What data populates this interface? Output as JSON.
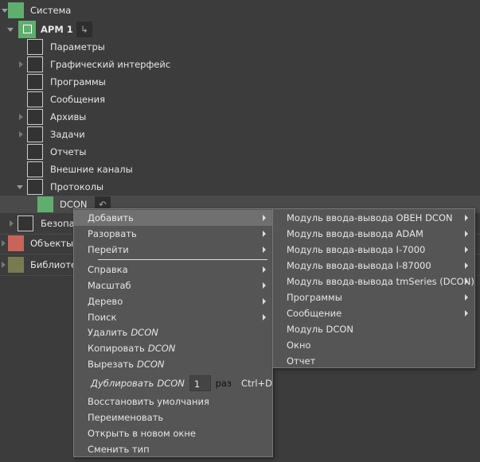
{
  "tree": {
    "root": "Система",
    "arm": "АРМ 1",
    "folders": [
      "Параметры",
      "Графический интерфейс",
      "Программы",
      "Сообщения",
      "Архивы",
      "Задачи",
      "Отчеты",
      "Внешние каналы",
      "Протоколы"
    ],
    "dcon": "DCON",
    "security": "Безопас",
    "objects": "Объекты",
    "libraries": "Библиоте"
  },
  "context_menu": {
    "items": [
      "Добавить",
      "Разорвать",
      "Перейти",
      "Справка",
      "Масштаб",
      "Дерево",
      "Поиск"
    ],
    "delete": {
      "label": "Удалить",
      "target": "DCON"
    },
    "copy": {
      "label": "Копировать",
      "target": "DCON"
    },
    "cut": {
      "label": "Вырезать",
      "target": "DCON"
    },
    "duplicate": {
      "label": "Дублировать",
      "target": "DCON",
      "count": "1",
      "times": "раз",
      "shortcut": "Ctrl+D"
    },
    "tail": [
      "Восстановить умолчания",
      "Переименовать",
      "Открыть в новом окне",
      "Сменить тип"
    ]
  },
  "submenu": {
    "items": [
      "Модуль ввода-вывода ОВЕН DCON",
      "Модуль ввода-вывода ADAM",
      "Модуль ввода-вывода I-7000",
      "Модуль ввода-вывода I-87000",
      "Модуль ввода-вывода tmSeries (DCON)",
      "Программы",
      "Сообщение",
      "Модуль DCON",
      "Окно",
      "Отчет"
    ]
  },
  "colors": {
    "system_icon": "#5fae6e",
    "objects_icon": "#c8645a",
    "libraries_icon": "#7a7a52",
    "highlight": "#707070"
  }
}
